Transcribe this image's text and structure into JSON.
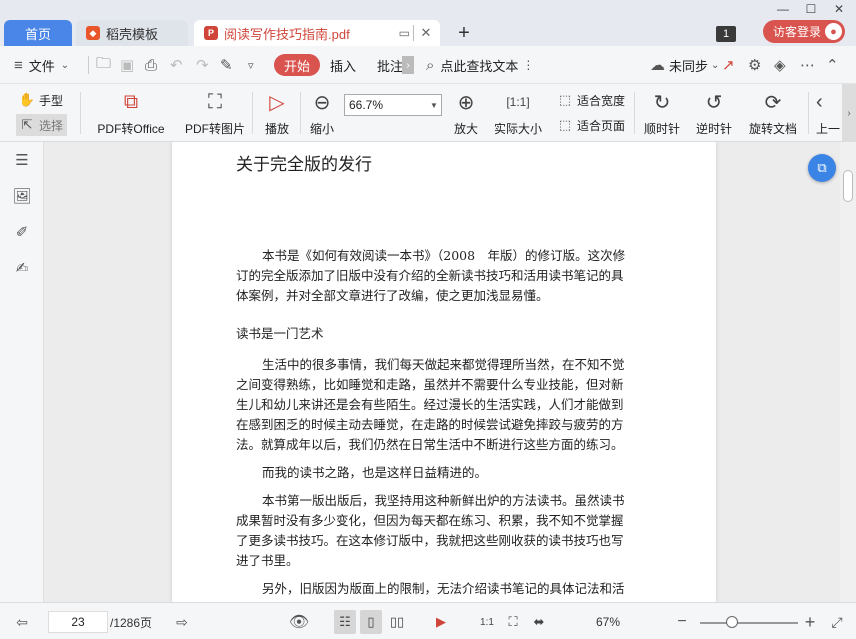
{
  "tabs": {
    "home": "首页",
    "template": "稻壳模板",
    "document": "阅读写作技巧指南.pdf",
    "badge_count": "1",
    "login": "访客登录"
  },
  "menu": {
    "file": "文件",
    "start": "开始",
    "insert": "插入",
    "annotate": "批注",
    "search": "点此查找文本",
    "sync": "未同步"
  },
  "ribbon": {
    "hand": "手型",
    "select": "选择",
    "pdf_to_office": "PDF转Office",
    "pdf_to_image": "PDF转图片",
    "play": "播放",
    "zoom_out": "缩小",
    "zoom_value": "66.7%",
    "zoom_in": "放大",
    "actual_size": "实际大小",
    "fit_width": "适合宽度",
    "fit_page": "适合页面",
    "rotate_cw": "顺时针",
    "rotate_ccw": "逆时针",
    "rotate_doc": "旋转文档",
    "prev": "上一"
  },
  "document": {
    "heading": "关于完全版的发行",
    "p1": [
      "本书是《如何有效阅读一本书》（2008　年版）的修订版。这次修",
      "订的完全版添加了旧版中没有介绍的全新读书技巧和活用读书笔记的具",
      "体案例，并对全部文章进行了改编，使之更加浅显易懂。"
    ],
    "section": "读书是一门艺术",
    "p2": [
      "生活中的很多事情，我们每天做起来都觉得理所当然，在不知不觉",
      "之间变得熟练，比如睡觉和走路，虽然并不需要什么专业技能，但对新",
      "生儿和幼儿来讲还是会有些陌生。经过漫长的生活实践，人们才能做到",
      "在感到困乏的时候主动去睡觉，在走路的时候尝试避免摔跤与疲劳的方",
      "法。就算成年以后，我们仍然在日常生活中不断进行这些方面的练习。"
    ],
    "p3": [
      "而我的读书之路，也是这样日益精进的。"
    ],
    "p4": [
      "本书第一版出版后，我坚持用这种新鲜出炉的方法读书。虽然读书",
      "成果暂时没有多少变化，但因为每天都在练习、积累，我不知不觉掌握",
      "了更多读书技巧。在这本修订版中，我就把这些刚收获的读书技巧也写",
      "进了书里。"
    ],
    "p5": [
      "另外，旧版因为版面上的限制，无法介绍读书笔记的具体记法和活"
    ]
  },
  "status": {
    "current_page": "23",
    "total_pages": "/1286页",
    "zoom": "67%"
  }
}
